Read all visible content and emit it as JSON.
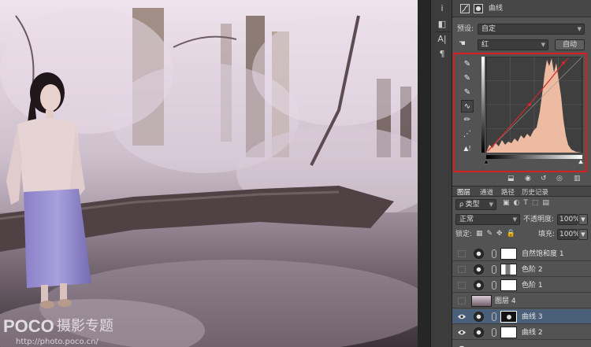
{
  "watermark": {
    "logo": "POCO",
    "logo_cn": "摄影专题",
    "url": "http://photo.poco.cn/"
  },
  "toolstrip": {
    "icons": [
      "info-icon",
      "histogram-icon",
      "character-icon",
      "paragraph-icon"
    ],
    "glyphs": [
      "i",
      "◧",
      "A|",
      "¶"
    ]
  },
  "properties": {
    "title": "曲线",
    "preset_label": "预设:",
    "preset_value": "自定",
    "channel_value": "红",
    "auto_label": "自动"
  },
  "curve_tools": [
    "sample-in-image-icon",
    "black-point-icon",
    "gray-point-icon",
    "white-point-icon",
    "curve-point-icon",
    "pencil-icon",
    "smooth-icon",
    "clipping-warning-icon"
  ],
  "layers_panel": {
    "tabs": [
      "图层",
      "通道",
      "路径",
      "历史记录"
    ],
    "filter_label": "类型",
    "blend_mode": "正常",
    "opacity_label": "不透明度:",
    "opacity_value": "100%",
    "lock_label": "锁定:",
    "fill_label": "填充:",
    "fill_value": "100%",
    "layers": [
      {
        "name": "自然饱和度 1",
        "visible": false,
        "kind": "adjustment",
        "selected": false
      },
      {
        "name": "色阶 2",
        "visible": false,
        "kind": "levels",
        "selected": false
      },
      {
        "name": "色阶 1",
        "visible": false,
        "kind": "levels",
        "selected": false
      },
      {
        "name": "图层 4",
        "visible": false,
        "kind": "pixel",
        "selected": false
      },
      {
        "name": "曲线 3",
        "visible": true,
        "kind": "curves",
        "selected": true
      },
      {
        "name": "曲线 2",
        "visible": true,
        "kind": "curves",
        "selected": false
      },
      {
        "name": "",
        "visible": true,
        "kind": "adjustment",
        "selected": false
      }
    ]
  },
  "colors": {
    "accent_red": "#d81e1e",
    "selection_blue": "#4a5f79",
    "histogram_fill": "#f5c2a8"
  }
}
